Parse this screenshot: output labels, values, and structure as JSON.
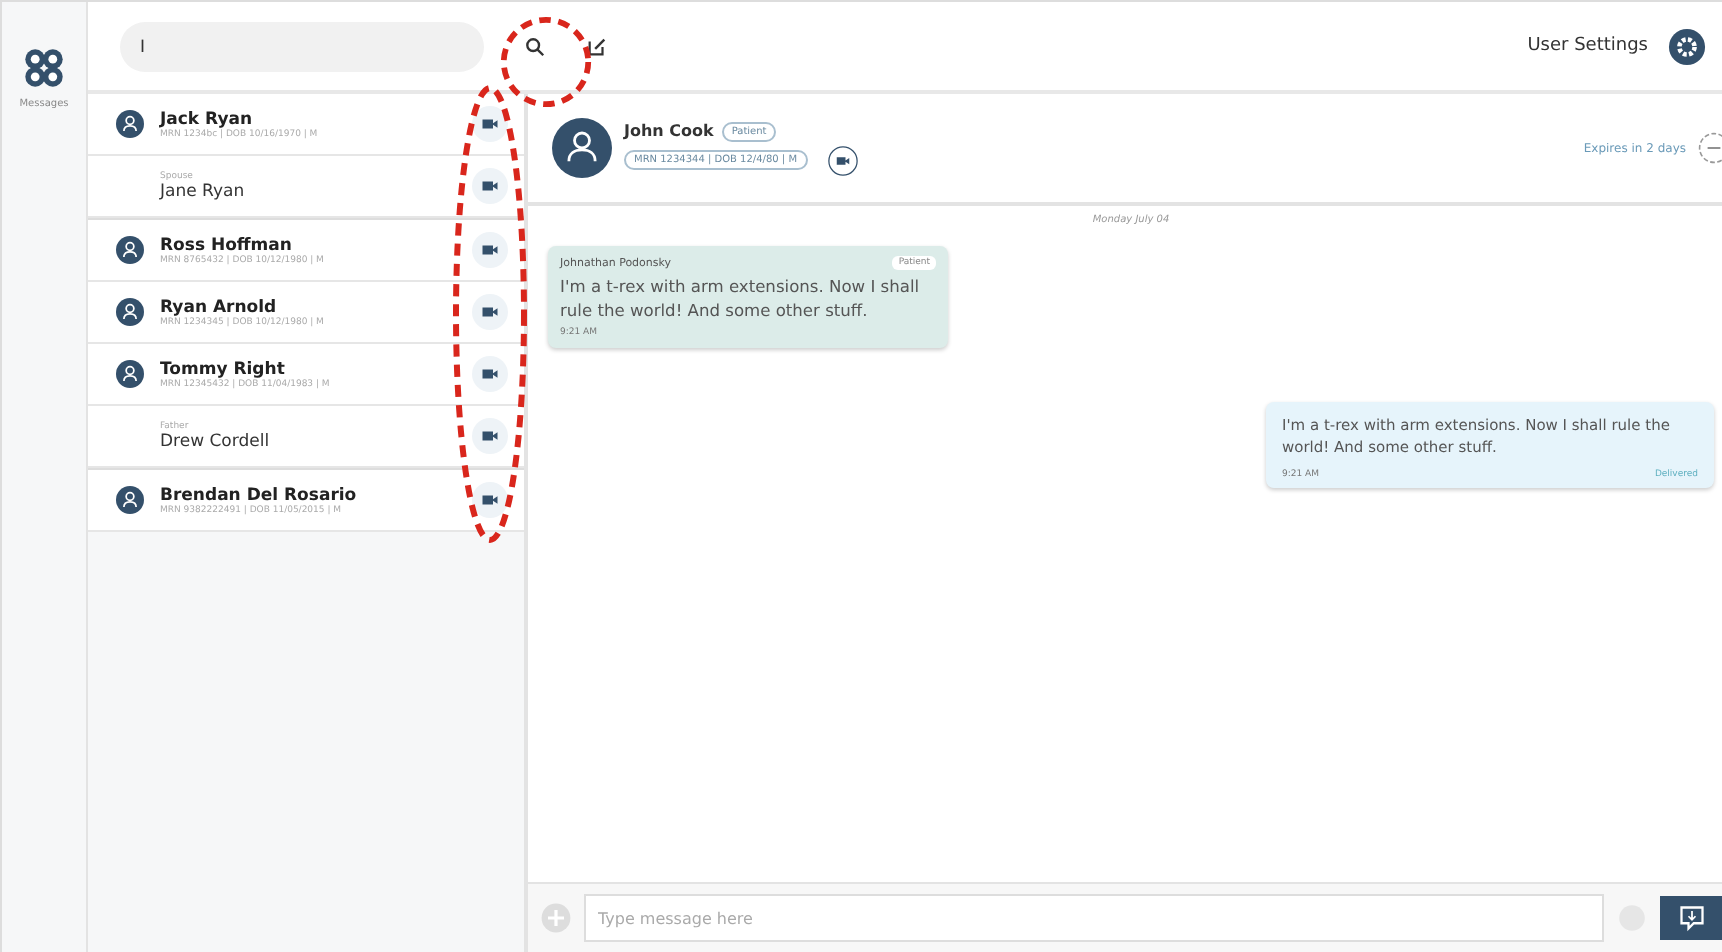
{
  "app": {
    "nav_label": "Messages"
  },
  "search": {
    "value": "I"
  },
  "user_settings": "User Settings",
  "contacts": [
    {
      "kind": "patient",
      "name": "Jack Ryan",
      "detail": "MRN 1234bc | DOB 10/16/1970 | M"
    },
    {
      "kind": "relative",
      "relation": "Spouse",
      "name": "Jane Ryan"
    },
    {
      "kind": "patient",
      "name": "Ross Hoffman",
      "detail": "MRN 8765432 | DOB 10/12/1980 | M"
    },
    {
      "kind": "patient",
      "name": "Ryan Arnold",
      "detail": "MRN 1234345 | DOB 10/12/1980 | M"
    },
    {
      "kind": "patient",
      "name": "Tommy Right",
      "detail": "MRN 12345432 | DOB 11/04/1983 | M"
    },
    {
      "kind": "relative",
      "relation": "Father",
      "name": "Drew Cordell"
    },
    {
      "kind": "patient",
      "name": "Brendan Del Rosario",
      "detail": "MRN 9382222491 | DOB 11/05/2015 | M"
    }
  ],
  "conversation": {
    "name": "John Cook",
    "role": "Patient",
    "detail": "MRN 1234344 | DOB 12/4/80 | M",
    "expires": "Expires in 2 days"
  },
  "date_divider": "Monday July 04",
  "messages": [
    {
      "kind": "incoming",
      "sender": "Johnathan Podonsky",
      "tag": "Patient",
      "text": "I'm a t-rex with arm extensions. Now I shall rule the world! And some other stuff.",
      "time": "9:21 AM"
    },
    {
      "kind": "outgoing",
      "text": "I'm a t-rex with arm extensions. Now I shall rule the world! And some other stuff.",
      "time": "9:21 AM",
      "status": "Delivered"
    }
  ],
  "composer": {
    "placeholder": "Type message here"
  }
}
